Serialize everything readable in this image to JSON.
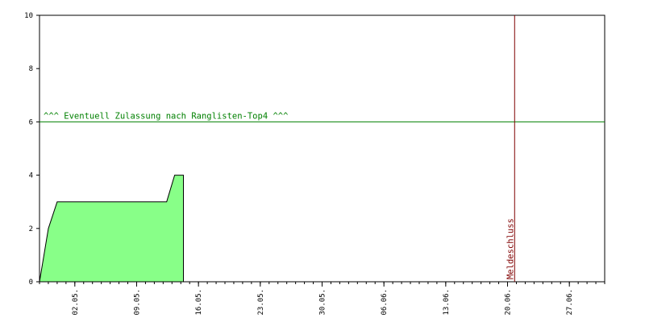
{
  "chart_data": {
    "type": "area",
    "title": "",
    "xlabel": "",
    "ylabel": "",
    "ylim": [
      0,
      10
    ],
    "y_ticks": [
      0,
      2,
      4,
      6,
      8,
      10
    ],
    "x_range_days": [
      0,
      64
    ],
    "x_ticks": [
      {
        "day": 4,
        "label": "02.05."
      },
      {
        "day": 11,
        "label": "09.05."
      },
      {
        "day": 18,
        "label": "16.05."
      },
      {
        "day": 25,
        "label": "23.05."
      },
      {
        "day": 32,
        "label": "30.05."
      },
      {
        "day": 39,
        "label": "06.06."
      },
      {
        "day": 46,
        "label": "13.06."
      },
      {
        "day": 53,
        "label": "20.06."
      },
      {
        "day": 60,
        "label": "27.06."
      }
    ],
    "series": [
      {
        "points": [
          [
            0,
            0
          ],
          [
            0.5,
            1
          ],
          [
            1,
            2
          ],
          [
            2,
            3
          ],
          [
            8,
            3
          ],
          [
            14.4,
            3
          ],
          [
            15.3,
            4
          ],
          [
            16.3,
            4
          ],
          [
            16.3,
            0
          ]
        ],
        "color": "#88ff88"
      }
    ],
    "threshold": {
      "value": 6,
      "label": "^^^ Eventuell Zulassung nach Ranglisten-Top4 ^^^",
      "color": "#008000"
    },
    "deadline": {
      "day": 53.8,
      "label": "Meldeschluss",
      "color": "#800000"
    }
  }
}
